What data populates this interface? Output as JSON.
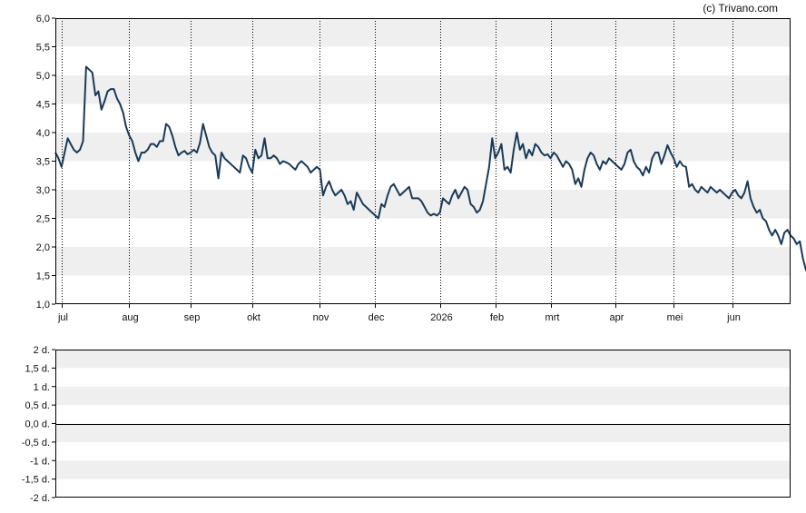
{
  "copyright": "(c) Trivano.com",
  "colors": {
    "line": "#1a3a57",
    "band": "#efefef",
    "frame": "#000000",
    "grid": "#000000"
  },
  "chart_data": [
    {
      "type": "line",
      "title": "",
      "xlabel": "",
      "ylabel": "",
      "ylim": [
        1.0,
        6.0
      ],
      "yticks": [
        "1,0",
        "1,5",
        "2,0",
        "2,5",
        "3,0",
        "3,5",
        "4,0",
        "4,5",
        "5,0",
        "5,5",
        "6,0"
      ],
      "xtick_labels": [
        "jul",
        "aug",
        "sep",
        "okt",
        "nov",
        "dec",
        "2026",
        "feb",
        "mrt",
        "apr",
        "mei",
        "jun"
      ],
      "xtick_positions": [
        2,
        24,
        44,
        64,
        86,
        104,
        125,
        143,
        161,
        182,
        201,
        220
      ],
      "xlim": [
        0,
        239
      ],
      "grid": true,
      "series": [
        {
          "values": [
            3.65,
            3.55,
            3.4,
            3.65,
            3.9,
            3.8,
            3.7,
            3.65,
            3.7,
            3.85,
            5.15,
            5.1,
            5.05,
            4.65,
            4.72,
            4.4,
            4.55,
            4.72,
            4.76,
            4.76,
            4.6,
            4.5,
            4.35,
            4.1,
            3.95,
            3.85,
            3.65,
            3.5,
            3.65,
            3.65,
            3.7,
            3.8,
            3.8,
            3.75,
            3.85,
            3.85,
            4.15,
            4.1,
            3.95,
            3.75,
            3.6,
            3.65,
            3.68,
            3.62,
            3.65,
            3.7,
            3.65,
            3.82,
            4.15,
            3.95,
            3.75,
            3.65,
            3.6,
            3.2,
            3.65,
            3.55,
            3.5,
            3.45,
            3.4,
            3.35,
            3.3,
            3.6,
            3.55,
            3.4,
            3.3,
            3.7,
            3.55,
            3.6,
            3.9,
            3.55,
            3.55,
            3.6,
            3.55,
            3.45,
            3.5,
            3.48,
            3.45,
            3.4,
            3.35,
            3.45,
            3.5,
            3.45,
            3.4,
            3.3,
            3.35,
            3.4,
            3.35,
            2.9,
            3.05,
            3.15,
            3.0,
            2.9,
            2.95,
            3.0,
            2.9,
            2.75,
            2.8,
            2.65,
            2.95,
            2.85,
            2.75,
            2.7,
            2.65,
            2.6,
            2.55,
            2.5,
            2.75,
            2.7,
            2.9,
            3.05,
            3.1,
            3.0,
            2.9,
            2.95,
            3.0,
            3.05,
            2.85,
            2.85,
            2.85,
            2.8,
            2.7,
            2.6,
            2.55,
            2.58,
            2.55,
            2.6,
            2.85,
            2.8,
            2.75,
            2.9,
            3.0,
            2.85,
            2.95,
            3.05,
            3.0,
            2.75,
            2.7,
            2.6,
            2.65,
            2.8,
            3.1,
            3.4,
            3.9,
            3.55,
            3.65,
            3.8,
            3.35,
            3.4,
            3.3,
            3.7,
            4.0,
            3.7,
            3.8,
            3.55,
            3.7,
            3.6,
            3.8,
            3.75,
            3.65,
            3.6,
            3.62,
            3.55,
            3.65,
            3.6,
            3.5,
            3.4,
            3.5,
            3.45,
            3.35,
            3.1,
            3.2,
            3.05,
            3.35,
            3.55,
            3.65,
            3.6,
            3.45,
            3.35,
            3.5,
            3.45,
            3.55,
            3.5,
            3.45,
            3.4,
            3.35,
            3.45,
            3.65,
            3.7,
            3.5,
            3.4,
            3.35,
            3.25,
            3.4,
            3.3,
            3.55,
            3.65,
            3.65,
            3.45,
            3.6,
            3.78,
            3.65,
            3.55,
            3.4,
            3.5,
            3.42,
            3.4,
            3.05,
            3.1,
            3.0,
            2.95,
            3.05,
            3.0,
            2.95,
            3.05,
            3.0,
            2.95,
            3.0,
            2.95,
            2.9,
            2.85,
            2.95,
            3.0,
            2.9,
            2.85,
            2.95,
            3.15,
            2.85,
            2.7,
            2.6,
            2.65,
            2.5,
            2.45,
            2.3,
            2.2,
            2.3,
            2.2,
            2.05,
            2.25,
            2.3,
            2.2,
            2.15,
            2.05,
            2.1,
            1.8,
            1.6,
            1.5
          ]
        }
      ]
    },
    {
      "type": "line",
      "title": "",
      "xlabel": "",
      "ylabel": "",
      "ylim": [
        -2.0,
        2.0
      ],
      "yticks": [
        "-2 d.",
        "-1,5 d.",
        "-1 d.",
        "-0,5 d.",
        "0,0 d.",
        "0,5 d.",
        "1 d.",
        "1,5 d.",
        "2 d."
      ],
      "grid": true,
      "series": []
    }
  ]
}
